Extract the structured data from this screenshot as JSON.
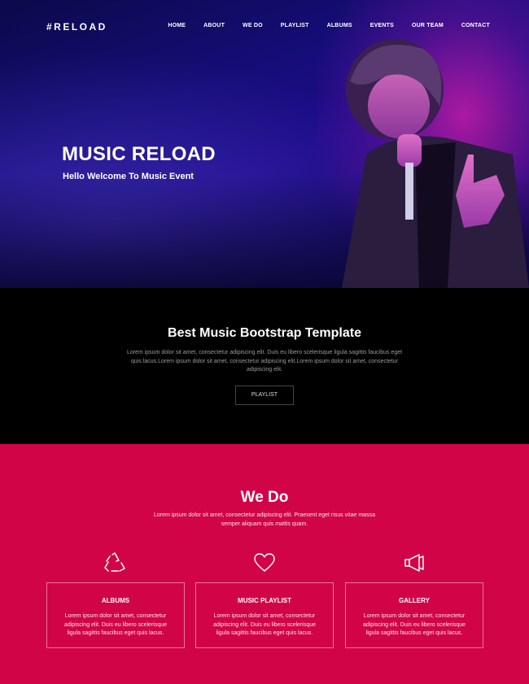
{
  "nav": {
    "brand": "#RELOAD",
    "links": [
      "HOME",
      "ABOUT",
      "WE DO",
      "PLAYLIST",
      "ALBUMS",
      "EVENTS",
      "OUR TEAM",
      "CONTACT"
    ]
  },
  "hero": {
    "title": "MUSIC RELOAD",
    "subtitle": "Hello Welcome To Music Event"
  },
  "intro": {
    "title": "Best Music Bootstrap Template",
    "text": "Lorem ipsum dolor sit amet, consectetur adipiscing elit. Duis eu libero scelerisque ligula sagittis faucibus eget quis lacus.Lorem ipsum dolor sit amet, consectetur adipiscing elit.Lorem ipsum dolor sit amet, consectetur adipiscing elit.",
    "button": "PLAYLIST"
  },
  "wedo": {
    "title": "We Do",
    "text": "Lorem ipsum dolor sit amet, consectetur adipiscing elit. Praesent eget risus vitae massa semper aliquam quis mattis quam.",
    "services": [
      {
        "icon": "recycle-icon",
        "title": "ALBUMS",
        "text": "Lorem ipsum dolor sit amet, consectetur adipiscing elit. Duis eu libero scelerisque ligula sagittis faucibus eget quis lacus."
      },
      {
        "icon": "heart-icon",
        "title": "MUSIC PLAYLIST",
        "text": "Lorem ipsum dolor sit amet, consectetur adipiscing elit. Duis eu libero scelerisque ligula sagittis faucibus eget quis lacus."
      },
      {
        "icon": "megaphone-icon",
        "title": "GALLERY",
        "text": "Lorem ipsum dolor sit amet, consectetur adipiscing elit. Duis eu libero scelerisque ligula sagittis faucibus eget quis lacus."
      }
    ]
  },
  "colors": {
    "accent": "#d10448",
    "hero_bg": "#160d7a",
    "intro_bg": "#000000"
  }
}
